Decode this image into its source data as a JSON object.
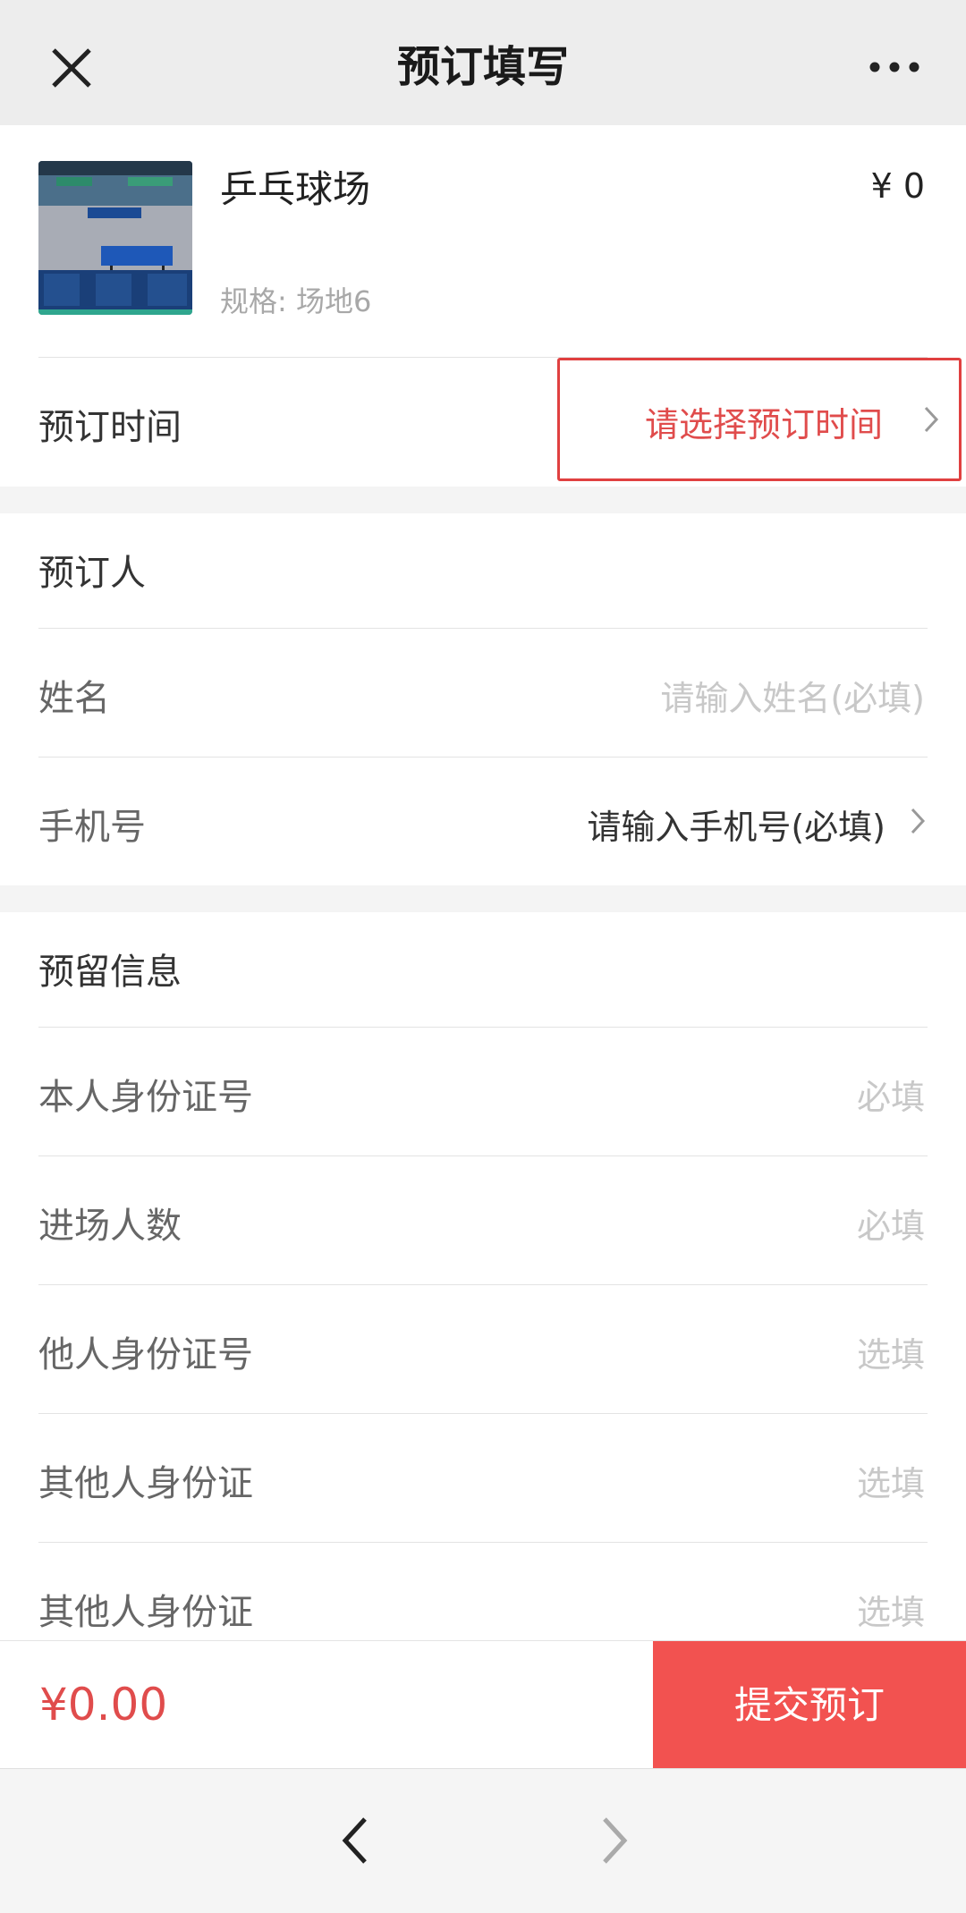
{
  "header": {
    "title": "预订填写",
    "close_icon": "close-icon",
    "more_icon": "more-icon"
  },
  "product": {
    "name": "乒乓球场",
    "spec": "规格: 场地6",
    "price": "¥ 0"
  },
  "booking_time": {
    "label": "预订时间",
    "value": "请选择预订时间",
    "value_color": "#e04c4c",
    "highlight_color": "#e04040"
  },
  "booker": {
    "title": "预订人",
    "name_label": "姓名",
    "name_placeholder": "请输入姓名(必填)",
    "phone_label": "手机号",
    "phone_value": "请输入手机号(必填)"
  },
  "reserved_info": {
    "title": "预留信息",
    "rows": [
      {
        "label": "本人身份证号",
        "placeholder": "必填"
      },
      {
        "label": "进场人数",
        "placeholder": "必填"
      },
      {
        "label": "他人身份证号",
        "placeholder": "选填"
      },
      {
        "label": "其他人身份证",
        "placeholder": "选填"
      },
      {
        "label": "其他人身份证",
        "placeholder": "选填"
      }
    ]
  },
  "footer": {
    "total": "¥0.00",
    "submit_label": "提交预订",
    "submit_color": "#f25250"
  },
  "navigation": {
    "back_icon": "chevron-left-icon",
    "forward_icon": "chevron-right-icon"
  }
}
